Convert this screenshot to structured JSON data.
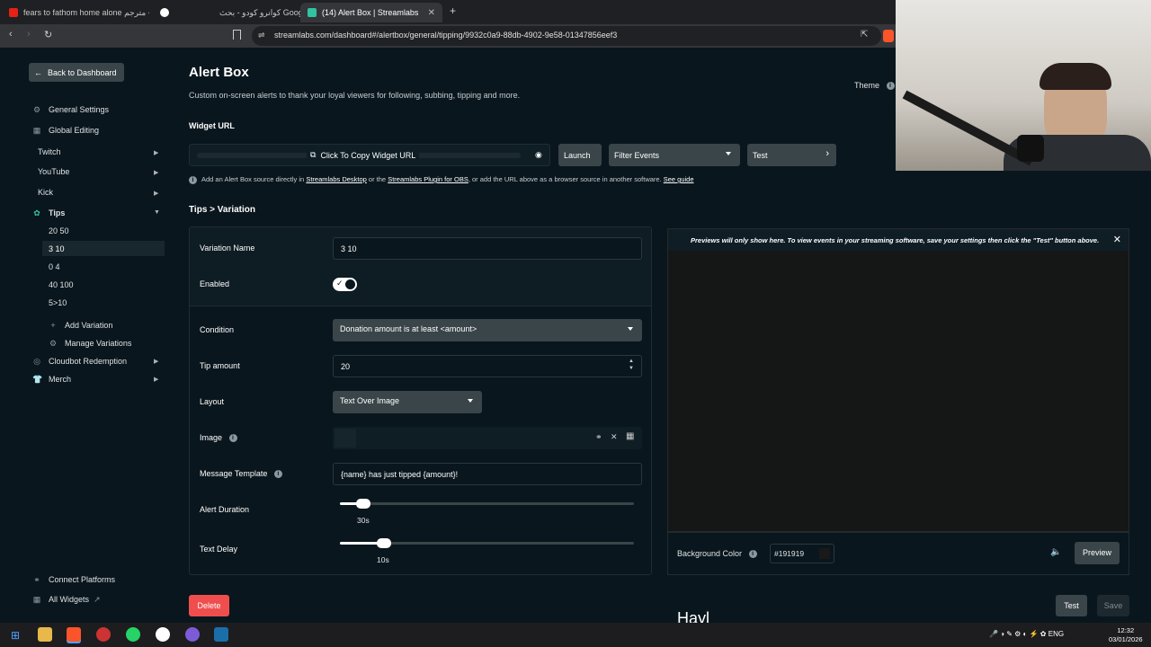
{
  "browser": {
    "tabs": [
      {
        "title": "fears to fathom home alone مترجم - Y",
        "active": false
      },
      {
        "title": "كوانرو كودو - بحث Google",
        "active": false
      },
      {
        "title": "(14) Alert Box | Streamlabs",
        "active": true
      }
    ],
    "new_tab": "+",
    "url": "streamlabs.com/dashboard#/alertbox/general/tipping/9932c0a9-88db-4902-9e58-01347856eef3"
  },
  "sidebar": {
    "back_label": "Back to Dashboard",
    "general_settings": "General Settings",
    "global_editing": "Global Editing",
    "twitch": "Twitch",
    "youtube": "YouTube",
    "kick": "Kick",
    "tips": "Tips",
    "tip_variations": [
      "20 50",
      "3 10",
      "0 4",
      "40 100",
      "5>10"
    ],
    "add_variation": "Add Variation",
    "manage_variations": "Manage Variations",
    "cloudbot": "Cloudbot Redemption",
    "merch": "Merch",
    "connect_platforms": "Connect Platforms",
    "all_widgets": "All Widgets"
  },
  "main": {
    "title": "Alert Box",
    "description": "Custom on-screen alerts to thank your loyal viewers for following, subbing, tipping and more.",
    "theme_label": "Theme",
    "widget_url_label": "Widget URL",
    "copy_widget_url": "Click To Copy Widget URL",
    "launch": "Launch",
    "filter_events": "Filter Events",
    "test": "Test",
    "info": {
      "pre": "Add an Alert Box source directly in ",
      "link1": "Streamlabs Desktop",
      "mid": " or the ",
      "link2": "Streamlabs Plugin for OBS",
      "post": ", or add the URL above as a browser source in another software. ",
      "link3": "See guide"
    },
    "breadcrumb": "Tips > Variation"
  },
  "form": {
    "variation_name_label": "Variation Name",
    "variation_name_value": "3  10",
    "enabled_label": "Enabled",
    "enabled": true,
    "condition_label": "Condition",
    "condition_value": "Donation amount is at least <amount>",
    "tip_amount_label": "Tip amount",
    "tip_amount_value": "20",
    "layout_label": "Layout",
    "layout_value": "Text Over Image",
    "image_label": "Image",
    "message_template_label": "Message Template",
    "message_template_value": "{name} has just tipped {amount}!",
    "alert_duration_label": "Alert Duration",
    "alert_duration_value": "30s",
    "alert_duration_fraction": 0.08,
    "text_delay_label": "Text Delay",
    "text_delay_value": "10s",
    "text_delay_fraction": 0.15
  },
  "preview": {
    "message": "Previews will only show here. To view events in your streaming software, save your settings then click the \"Test\" button above.",
    "background_color_label": "Background Color",
    "background_color_value": "#191919",
    "preview_button": "Preview"
  },
  "actions": {
    "delete": "Delete",
    "test": "Test",
    "save": "Save"
  },
  "overlay_caption": "Hayl",
  "taskbar": {
    "language": "ENG",
    "time": "12:32",
    "date": "03/01/2026"
  },
  "colors": {
    "background": "#09161d",
    "delete": "#f04e4e",
    "button": "#3a4549"
  }
}
